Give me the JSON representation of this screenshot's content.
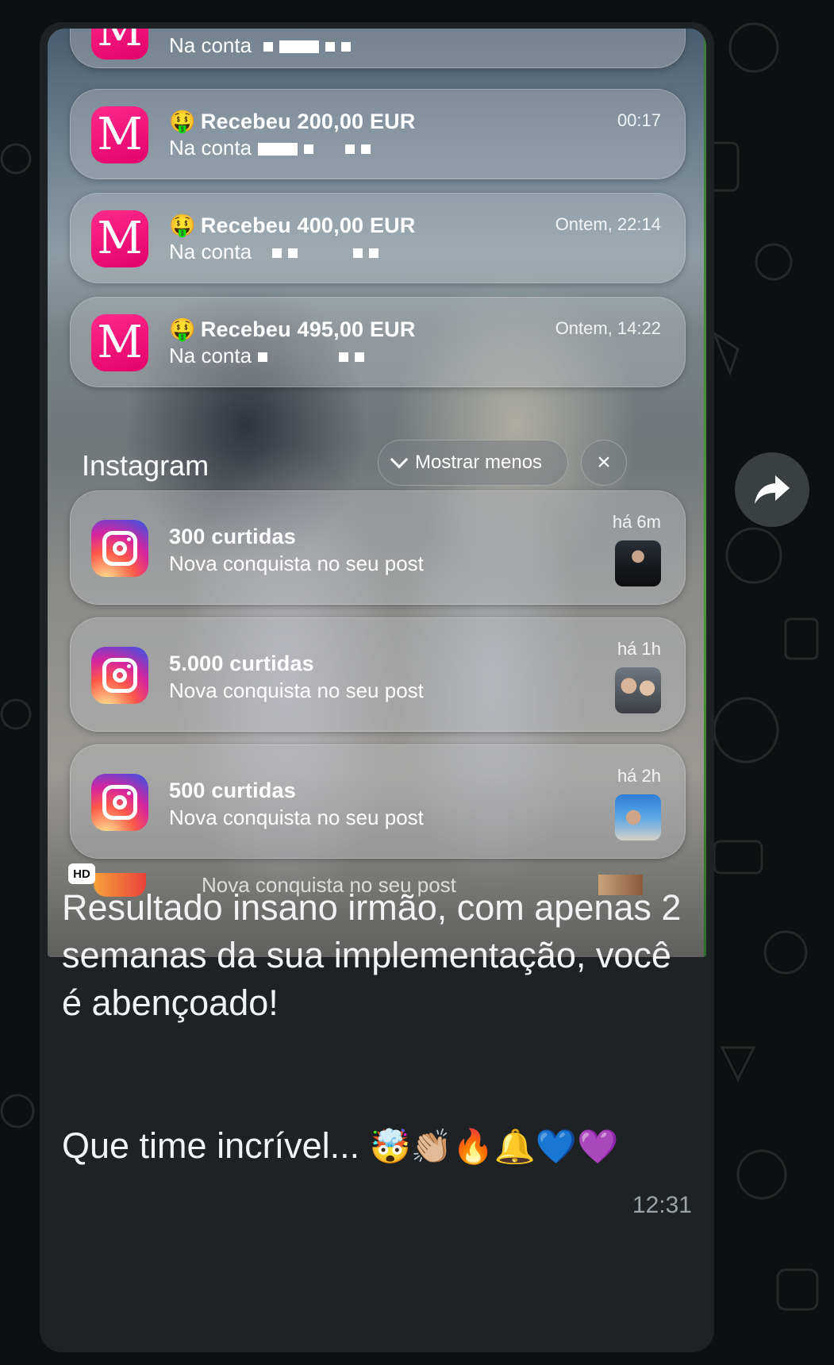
{
  "notifications_bank": [
    {
      "app": "M",
      "title": "Recebeu 200,00 EUR",
      "emoji": "🤑",
      "body": "Na conta",
      "time": "00:17"
    },
    {
      "app": "M",
      "title": "Recebeu 400,00 EUR",
      "emoji": "🤑",
      "body": "Na conta",
      "time": "Ontem, 22:14"
    },
    {
      "app": "M",
      "title": "Recebeu 495,00 EUR",
      "emoji": "🤑",
      "body": "Na conta",
      "time": "Ontem, 14:22"
    }
  ],
  "partial_top": {
    "body": "Na conta"
  },
  "instagram_group": {
    "title": "Instagram",
    "show_less_label": "Mostrar menos",
    "close_icon": "×",
    "items": [
      {
        "title": "300 curtidas",
        "body": "Nova conquista no seu post",
        "time": "há 6m"
      },
      {
        "title": "5.000 curtidas",
        "body": "Nova conquista no seu post",
        "time": "há 1h"
      },
      {
        "title": "500 curtidas",
        "body": "Nova conquista no seu post",
        "time": "há 2h"
      }
    ],
    "peek_body": "Nova conquista no seu post"
  },
  "hd_badge": "HD",
  "message": {
    "text": "Resultado insano irmão, com apenas 2 semanas da sua implementação, você é abençoado!",
    "text2": "Que time incrível...",
    "emojis": "🤯👏🏼🔥🔔💙💜",
    "time": "12:31"
  },
  "colors": {
    "bubble": "#1f2224",
    "background": "#0d0f10",
    "brand_pink": "#e3006b"
  },
  "icons": {
    "forward": "forward-arrow-icon",
    "show_less": "chevron-down-icon",
    "close": "close-icon"
  }
}
